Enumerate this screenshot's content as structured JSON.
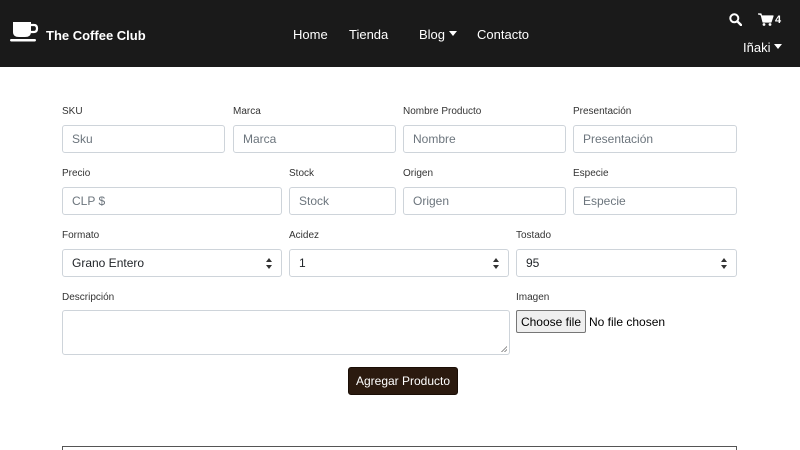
{
  "navbar": {
    "brand": "The Coffee Club",
    "links": [
      "Home",
      "Tienda",
      "Blog",
      "Contacto"
    ],
    "cart_count": "4",
    "user": "Iñaki",
    "icons": [
      "coffee-cup-icon",
      "search-icon",
      "cart-icon"
    ]
  },
  "form": {
    "sku": {
      "label": "SKU",
      "placeholder": "Sku"
    },
    "marca": {
      "label": "Marca",
      "placeholder": "Marca"
    },
    "nombre": {
      "label": "Nombre Producto",
      "placeholder": "Nombre"
    },
    "presentacion": {
      "label": "Presentación",
      "placeholder": "Presentación"
    },
    "precio": {
      "label": "Precio",
      "placeholder": "CLP $"
    },
    "stock": {
      "label": "Stock",
      "placeholder": "Stock"
    },
    "origen": {
      "label": "Origen",
      "placeholder": "Origen"
    },
    "especie": {
      "label": "Especie",
      "placeholder": "Especie"
    },
    "formato": {
      "label": "Formato",
      "value": "Grano Entero"
    },
    "acidez": {
      "label": "Acidez",
      "value": "1"
    },
    "tostado": {
      "label": "Tostado",
      "value": "95"
    },
    "descripcion": {
      "label": "Descripción"
    },
    "imagen": {
      "label": "Imagen",
      "button": "Choose file",
      "status": "No file chosen"
    },
    "submit": "Agregar Producto"
  },
  "colors": {
    "navbar_bg": "#1a1a1a",
    "button_bg": "#2b1a0f"
  }
}
